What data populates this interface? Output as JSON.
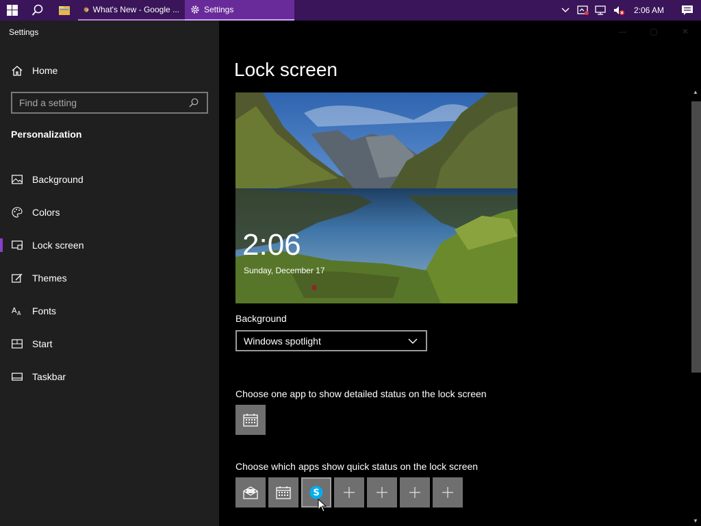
{
  "taskbar": {
    "chrome_tab": "What's New - Google ...",
    "settings_tab": "Settings",
    "clock": "2:06 AM"
  },
  "sidebar": {
    "app_title": "Settings",
    "home": "Home",
    "search_placeholder": "Find a setting",
    "section": "Personalization",
    "items": [
      {
        "label": "Background",
        "icon": "picture-icon"
      },
      {
        "label": "Colors",
        "icon": "palette-icon"
      },
      {
        "label": "Lock screen",
        "icon": "lock-screen-icon",
        "active": true
      },
      {
        "label": "Themes",
        "icon": "brush-icon"
      },
      {
        "label": "Fonts",
        "icon": "fonts-icon"
      },
      {
        "label": "Start",
        "icon": "start-icon"
      },
      {
        "label": "Taskbar",
        "icon": "taskbar-icon"
      }
    ]
  },
  "main": {
    "title": "Lock screen",
    "preview": {
      "time": "2:06",
      "date": "Sunday, December 17"
    },
    "background_label": "Background",
    "background_value": "Windows spotlight",
    "detailed_status_label": "Choose one app to show detailed status on the lock screen",
    "detailed_status_app": "calendar-icon",
    "quick_status_label": "Choose which apps show quick status on the lock screen",
    "quick_status_apps": [
      "mail-icon",
      "calendar-icon",
      "skype-icon",
      "plus-icon",
      "plus-icon",
      "plus-icon",
      "plus-icon"
    ]
  },
  "colors": {
    "taskbar": "#3a1559",
    "accent": "#8a3fc8",
    "sidebar": "#1f1f1f"
  }
}
